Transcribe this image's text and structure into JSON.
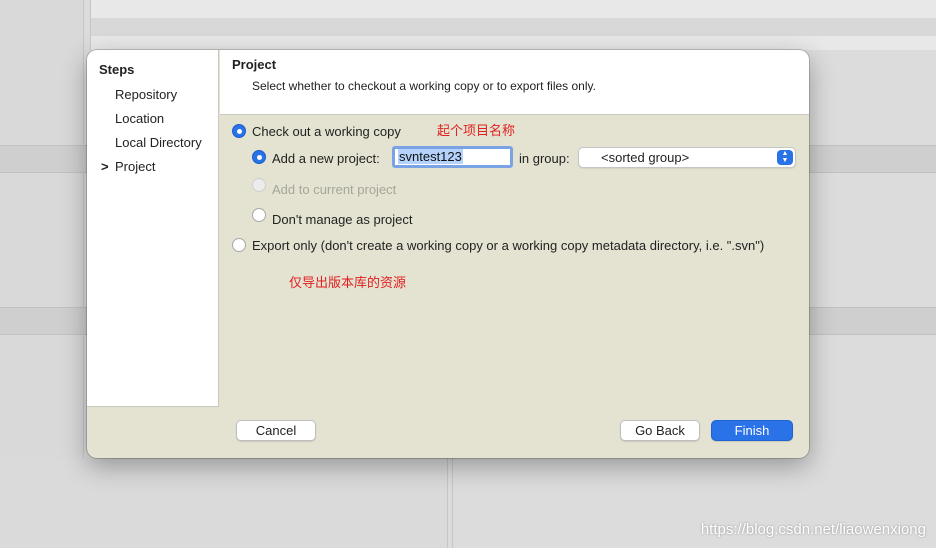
{
  "sidebar": {
    "title": "Steps",
    "items": [
      {
        "label": "Repository"
      },
      {
        "label": "Location"
      },
      {
        "label": "Local Directory"
      },
      {
        "label": "Project",
        "current": true
      }
    ],
    "current_marker": ">"
  },
  "header": {
    "title": "Project",
    "subtitle": "Select whether to checkout a working copy or to export files only."
  },
  "options": {
    "checkout": {
      "label": "Check out a working copy",
      "selected": true
    },
    "add_new_project": {
      "label": "Add a new project:",
      "selected": true,
      "value": "svntest123",
      "group_label": "in group:",
      "group_value": "<sorted group>"
    },
    "add_current_project": {
      "label": "Add to current project",
      "enabled": false
    },
    "dont_manage": {
      "label": "Don't manage as project",
      "selected": false
    },
    "export_only": {
      "label": "Export only (don't create a working copy or a working copy metadata directory, i.e. \".svn\")",
      "selected": false
    }
  },
  "annotations": {
    "project_name": "起个项目名称",
    "export_note": "仅导出版本库的资源"
  },
  "buttons": {
    "cancel": "Cancel",
    "go_back": "Go Back",
    "finish": "Finish"
  },
  "watermark": "https://blog.csdn.net/liaowenxiong",
  "colors": {
    "accent": "#2a72e8",
    "annotation": "#e02020",
    "dialog_bg": "#e4e3d1"
  }
}
